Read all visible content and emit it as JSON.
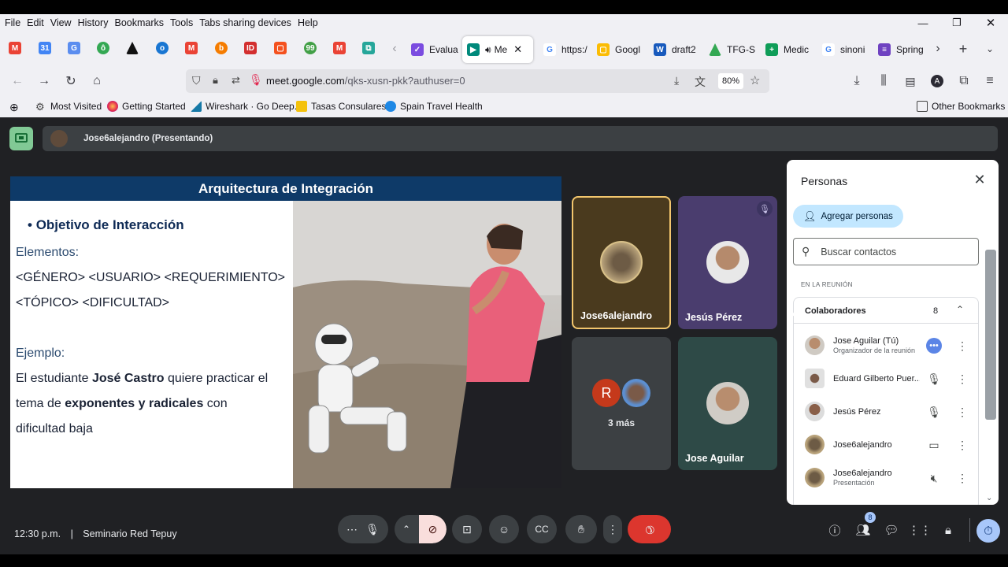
{
  "menu": [
    "File",
    "Edit",
    "View",
    "History",
    "Bookmarks",
    "Tools",
    "Tabs sharing devices",
    "Help"
  ],
  "tabs": [
    {
      "label": "Evalua",
      "color": "#7b4ce0"
    },
    {
      "label": "Me",
      "color": "#00897b"
    },
    {
      "label": "https:/",
      "color": "#4285f4"
    },
    {
      "label": "Googl",
      "color": "#fbbc04"
    },
    {
      "label": "draft2",
      "color": "#185abd"
    },
    {
      "label": "TFG-S",
      "color": "#34a853"
    },
    {
      "label": "Medic",
      "color": "#0f9d58"
    },
    {
      "label": "sinoni",
      "color": "#4285f4"
    },
    {
      "label": "Spring",
      "color": "#6f42c1"
    }
  ],
  "address": {
    "host": "meet.google.com",
    "path": "/qks-xusn-pkk?authuser=0",
    "zoom": "80%"
  },
  "bookmarks": [
    "Most Visited",
    "Getting Started",
    "Wireshark · Go Deep.",
    "Tasas Consulares",
    "Spain Travel Health",
    "Other Bookmarks"
  ],
  "meet": {
    "presenting_label": "Jose6alejandro (Presentando)",
    "slide": {
      "title": "Arquitectura de Integración",
      "bullet": "Objetivo de Interacción",
      "elementos_label": "Elementos:",
      "elementos_line1": "<GÉNERO> <USUARIO> <REQUERIMIENTO>",
      "elementos_line2": "<TÓPICO> <DIFICULTAD>",
      "ejemplo_label": "Ejemplo:",
      "ex1_a": "El estudiante ",
      "ex1_b": "José Castro",
      "ex1_c": " quiere practicar el",
      "ex2_a": "tema de ",
      "ex2_b": "exponentes y radicales",
      "ex2_c": " con",
      "ex3": "dificultad baja"
    },
    "tiles": [
      {
        "name": "Jose6alejandro"
      },
      {
        "name": "Jesús Pérez"
      },
      {
        "name": "3 más",
        "initial": "R"
      },
      {
        "name": "Jose Aguilar"
      }
    ],
    "people": {
      "title": "Personas",
      "add_label": "Agregar personas",
      "search_placeholder": "Buscar contactos",
      "section": "EN LA REUNIÓN",
      "group_label": "Colaboradores",
      "group_count": "8",
      "rows": [
        {
          "name": "Jose Aguilar (Tú)",
          "sub": "Organizador de la reunión"
        },
        {
          "name": "Eduard Gilberto Puer...",
          "sub": ""
        },
        {
          "name": "Jesús Pérez",
          "sub": ""
        },
        {
          "name": "Jose6alejandro",
          "sub": ""
        },
        {
          "name": "Jose6alejandro",
          "sub": "Presentación"
        }
      ]
    },
    "bottom": {
      "time": "12:30 p.m.",
      "separator": "|",
      "meeting": "Seminario Red Tepuy",
      "participants_badge": "8"
    }
  }
}
